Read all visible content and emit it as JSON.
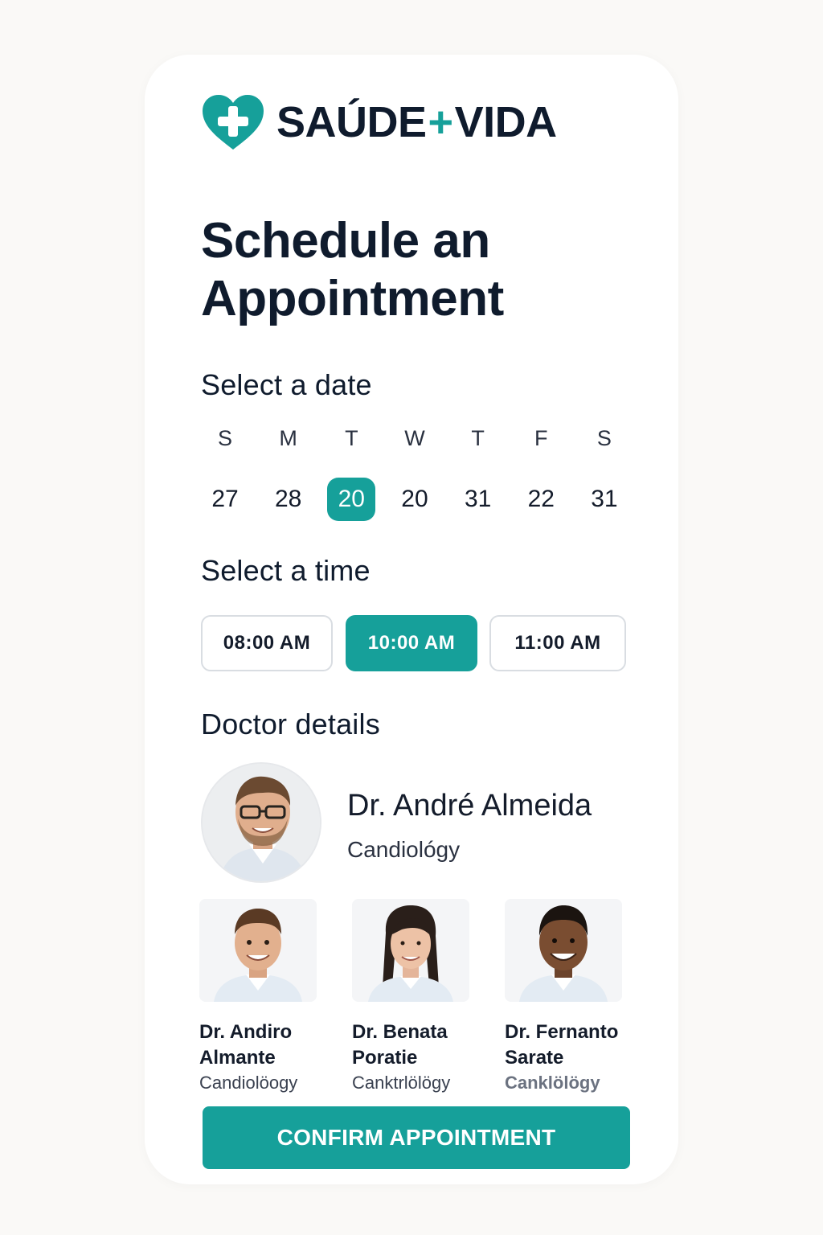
{
  "brand": {
    "name_left": "SAÚDE",
    "name_plus": "+",
    "name_right": "VIDA",
    "logo_icon": "heart-plus-icon",
    "accent_color": "#16a09a"
  },
  "page": {
    "title": "Schedule an Appointment"
  },
  "date_section": {
    "title": "Select a date",
    "weekdays": [
      "S",
      "M",
      "T",
      "W",
      "T",
      "F",
      "S"
    ],
    "days": [
      "27",
      "28",
      "20",
      "20",
      "31",
      "22",
      "31"
    ],
    "selected_index": 2
  },
  "time_section": {
    "title": "Select a time",
    "slots": [
      "08:00 AM",
      "10:00 AM",
      "11:00 AM"
    ],
    "selected_index": 1
  },
  "doctor_section": {
    "title": "Doctor details",
    "selected_doctor": {
      "name": "Dr. André Almeida",
      "specialty": "Candiológy"
    },
    "doctors": [
      {
        "name_line1": "Dr. Andiro",
        "name_line2": "Almante",
        "specialty": "Candiolöogy"
      },
      {
        "name_line1": "Dr. Benata",
        "name_line2": "Poratie",
        "specialty": "Canktrlölögy"
      },
      {
        "name_line1": "Dr. Fernanto",
        "name_line2": "Sarate",
        "specialty": "Canklölögy"
      }
    ]
  },
  "actions": {
    "confirm_label": "CONFIRM APPOINTMENT"
  }
}
